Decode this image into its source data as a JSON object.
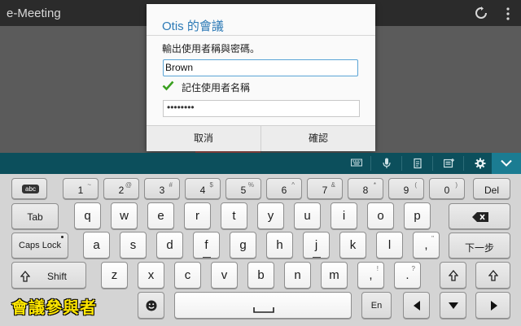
{
  "app": {
    "title": "e-Meeting"
  },
  "dialog": {
    "title": "Otis 的會議",
    "message": "輸出使用者稱與密碼。",
    "username_value": "Brown",
    "remember_label": "記住使用者名稱",
    "password_value": "••••••••",
    "cancel_label": "取消",
    "ok_label": "確認"
  },
  "toolbar": {
    "icons": [
      "keyboard-icon",
      "microphone-icon",
      "clipboard-icon",
      "emoji-add-icon",
      "settings-icon"
    ],
    "collapse_icon": "chevron-down-icon"
  },
  "keyboard": {
    "abc_label": "abc",
    "row1": [
      {
        "m": "1",
        "s": "~"
      },
      {
        "m": "2",
        "s": "@"
      },
      {
        "m": "3",
        "s": "#"
      },
      {
        "m": "4",
        "s": "$"
      },
      {
        "m": "5",
        "s": "%"
      },
      {
        "m": "6",
        "s": "^"
      },
      {
        "m": "7",
        "s": "&"
      },
      {
        "m": "8",
        "s": "*"
      },
      {
        "m": "9",
        "s": "("
      },
      {
        "m": "0",
        "s": ")"
      }
    ],
    "del": "Del",
    "tab": "Tab",
    "row2": [
      "q",
      "w",
      "e",
      "r",
      "t",
      "y",
      "u",
      "i",
      "o",
      "p"
    ],
    "caps": "Caps Lock",
    "row3": [
      "a",
      "s",
      "d",
      "f",
      "g",
      "h",
      "j",
      "k",
      "l"
    ],
    "row3_punct": {
      "m": ",",
      "s": "\""
    },
    "next": "下一步",
    "shift": "Shift",
    "row4": [
      "z",
      "x",
      "c",
      "v",
      "b",
      "n",
      "m"
    ],
    "row4_punct": [
      {
        "m": ",",
        "s": "!"
      },
      {
        "m": ".",
        "s": "?"
      }
    ],
    "lang": "En"
  },
  "overlay_label": "會議參與者",
  "colors": {
    "toolbar": "#0c4f5c",
    "accent": "#1b7c92",
    "dialog_title": "#2c7ab6",
    "check": "#3aa020",
    "label": "#ffe600"
  }
}
